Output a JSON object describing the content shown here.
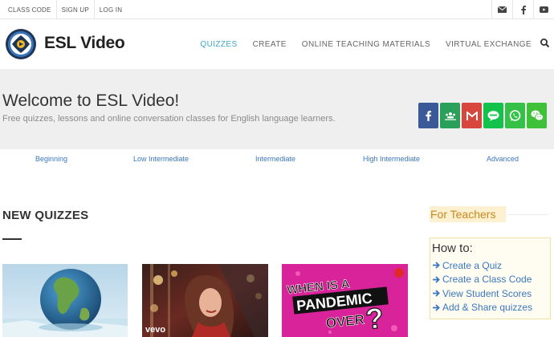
{
  "topbar": {
    "links": [
      "CLASS CODE",
      "SIGN UP",
      "LOG IN"
    ],
    "icons": [
      "envelope-icon",
      "facebook-icon",
      "youtube-icon"
    ]
  },
  "header": {
    "brand": "ESL Video",
    "nav": [
      {
        "label": "QUIZZES",
        "active": true
      },
      {
        "label": "CREATE",
        "active": false
      },
      {
        "label": "ONLINE TEACHING MATERIALS",
        "active": false
      },
      {
        "label": "VIRTUAL EXCHANGE",
        "active": false
      }
    ],
    "accent": "#3da9c8"
  },
  "hero": {
    "title": "Welcome to ESL Video!",
    "subtitle": "Free quizzes, lessons and online conversation classes for English language learners.",
    "share_buttons": [
      {
        "icon": "facebook-icon",
        "color": "#3b5998"
      },
      {
        "icon": "classroom-icon",
        "color": "#2aa05a"
      },
      {
        "icon": "gmail-icon",
        "color": "#d9463d"
      },
      {
        "icon": "line-icon",
        "color": "#12c24a"
      },
      {
        "icon": "whatsapp-icon",
        "color": "#35c148"
      },
      {
        "icon": "wechat-icon",
        "color": "#3fc23a"
      }
    ]
  },
  "levels": [
    "Beginning",
    "Low Intermediate",
    "Intermediate",
    "High Intermediate",
    "Advanced"
  ],
  "new_quizzes": {
    "title": "NEW QUIZZES",
    "thumbnails": [
      {
        "name": "earth-thumbnail",
        "caption": ""
      },
      {
        "name": "singer-video-thumbnail",
        "caption": "vevo"
      },
      {
        "name": "pandemic-thumbnail",
        "caption": "WHEN IS A PANDEMIC OVER?"
      }
    ]
  },
  "teachers": {
    "title": "For Teachers",
    "howto_title": "How to:",
    "items": [
      "Create a Quiz",
      "Create a Class Code",
      "View Student Scores",
      "Add & Share quizzes"
    ]
  }
}
